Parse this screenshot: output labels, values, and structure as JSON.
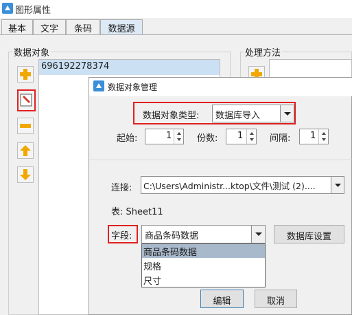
{
  "window": {
    "title": "图形属性"
  },
  "tabs": [
    {
      "label": "基本"
    },
    {
      "label": "文字"
    },
    {
      "label": "条码"
    },
    {
      "label": "数据源"
    }
  ],
  "data_objects": {
    "group_label": "数据对象",
    "items": [
      "696192278374"
    ]
  },
  "processing": {
    "group_label": "处理方法"
  },
  "dialog": {
    "title": "数据对象管理",
    "type_label": "数据对象类型:",
    "type_value": "数据库导入",
    "start_label": "起始:",
    "start_value": "1",
    "copies_label": "份数:",
    "copies_value": "1",
    "interval_label": "间隔:",
    "interval_value": "1",
    "connection_label": "连接:",
    "connection_value": "C:\\Users\\Administr...ktop\\文件\\测试 (2)....",
    "table_text": "表: Sheet11",
    "field_label": "字段:",
    "field_value": "商品条码数据",
    "db_settings_button": "数据库设置",
    "field_options": [
      "商品条码数据",
      "规格",
      "尺寸"
    ],
    "edit_button": "编辑",
    "cancel_button": "取消"
  },
  "colors": {
    "highlight_border": "#e02020",
    "selection": "#cce0f4",
    "dropdown_selection": "#a8b9cc"
  }
}
